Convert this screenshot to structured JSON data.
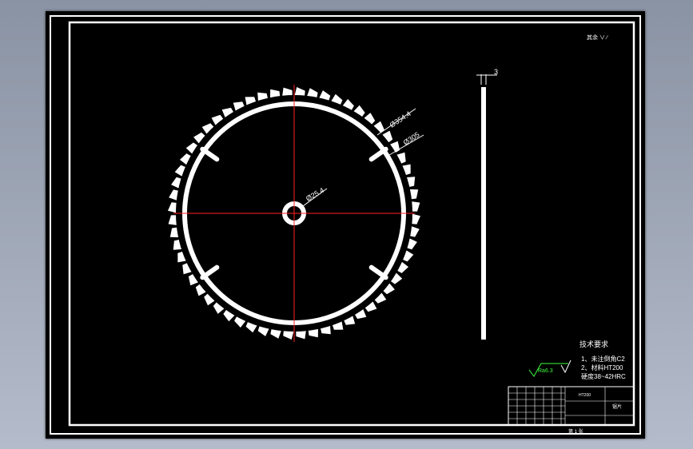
{
  "colors": {
    "background": "#8a93a3",
    "sheet": "#000000",
    "lines": "#ffffff",
    "centerline": "#ff2020",
    "roughness_symbol": "#3cff3c"
  },
  "dimensions": {
    "outer_diameter": "Ø354.4",
    "inner_ring": "Ø305",
    "bore": "Ø25.4",
    "thickness": "3"
  },
  "roughness": {
    "corner_note": "其余 ∨ ∕",
    "general_symbol": "Ra6.3"
  },
  "technical_requirements": {
    "title": "技术要求",
    "item1": "1、未注倒角C2",
    "item2": "2、材料HT200",
    "item3": "硬度38~42HRC"
  },
  "title_block": {
    "material": "HT200",
    "part_name": "锯片",
    "sheet_label": "第 1 张"
  }
}
